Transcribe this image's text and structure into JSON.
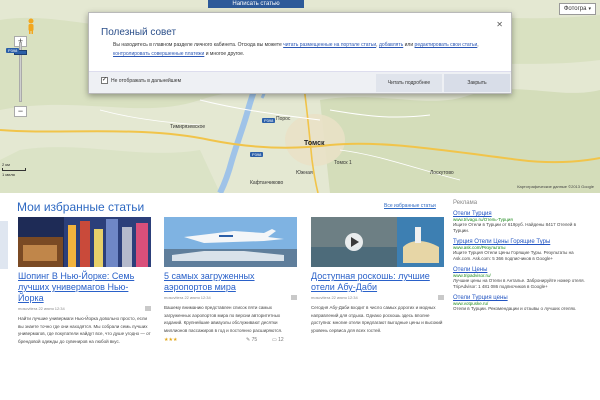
{
  "map": {
    "top_tab": "Написать статью",
    "type_button": "Фотогра",
    "city": "Томск",
    "labels": [
      "Тимирязевское",
      "Томск 1",
      "Кафтанчиково",
      "Порос",
      "Южная",
      "Лоскутово"
    ],
    "roads": [
      "Р398",
      "Р398",
      "Р398"
    ],
    "scale_top": "2 км",
    "scale_bottom": "1 миля",
    "copyright": "Картографические данные ©2013 Google"
  },
  "tip": {
    "title": "Полезный совет",
    "body_1": "Вы находитесь в главном разделе личного кабинета. Отсюда вы можете ",
    "link_1": "читать размещенные на портале статьи",
    "sep_1": ", ",
    "link_2": "добавлять",
    "body_2": " или ",
    "link_3": "редактировать свои статьи",
    "sep_2": ", ",
    "link_4": "контролировать совершенные платежи",
    "body_3": " и многое другое.",
    "checkbox_label": "Не отображать в дальнейшем",
    "read_more": "Читать подробнее",
    "close": "Закрыть"
  },
  "main": {
    "section_title": "Мои избранные статьи",
    "all_link": "Все избранные статьи"
  },
  "cards": [
    {
      "title": "Шопинг В Нью-Йорке: Семь лучших универмагов Нью-Йорка",
      "meta": "moscvitera  22 июня 12:34",
      "excerpt": "Найти лучшие универмаги Нью-Йорка довольно просто, если вы знаете точно где они находятся. Мы собрали семь лучших универмагов, где покупатели найдут все, что душе угодно — от брендовой одежды до сувениров на любой вкус."
    },
    {
      "title": "5 самых загруженных аэропортов мира",
      "meta": "moscvitera  22 июня 12:34",
      "excerpt": "Вашему вниманию представлен список пяти самых загруженных аэропортов мира по версии авторитетных изданий. Крупнейшие авиаузлы обслуживают десятки миллионов пассажиров в год и постоянно расширяются.",
      "stars": "★★★",
      "comments": "75",
      "views": "12"
    },
    {
      "title": "Доступная роскошь: лучшие отели Абу-Даби",
      "meta": "moscvitera  22 июня 12:34",
      "excerpt": "Сегодня Абу-Даби входит в число самых дорогих и модных направлений для отдыха. Однако роскошь здесь вполне доступна: многие отели предлагают выгодные цены и высокий уровень сервиса для всех гостей."
    }
  ],
  "ads": {
    "title": "Реклама",
    "items": [
      {
        "title": "Отели Турция",
        "url": "www.trivago.ru/Отель-Турция",
        "text": "Ищите Отели в Турции от 619руб. Найдены 8417 Отелей в Турции."
      },
      {
        "title": "Турция Отели Цены Горящие Туры",
        "url": "www.ask.com/Результаты",
        "text": "Ищите Турция Отели Цены Горящие Туры. Результаты на Ask.com. Ask.com: 5 366 подписчиков в Google+"
      },
      {
        "title": "Отели Цены",
        "url": "www.tripadvisor.ru/",
        "text": "Лучшие цены на Отели в Анталье. Забронируйте номер отеля. TripAdvisor: 1 481 086 подписчиков в Google+"
      },
      {
        "title": "Отели Турция цены",
        "url": "www.votpuske.ru/",
        "text": "Отели в Турции. Рекомендации и отзывы о лучших отелях."
      }
    ],
    "google": "Google"
  },
  "colors": {
    "accent": "#2e69c2",
    "tip_title": "#2b4f8a",
    "ad_url": "#1d8a1d"
  }
}
